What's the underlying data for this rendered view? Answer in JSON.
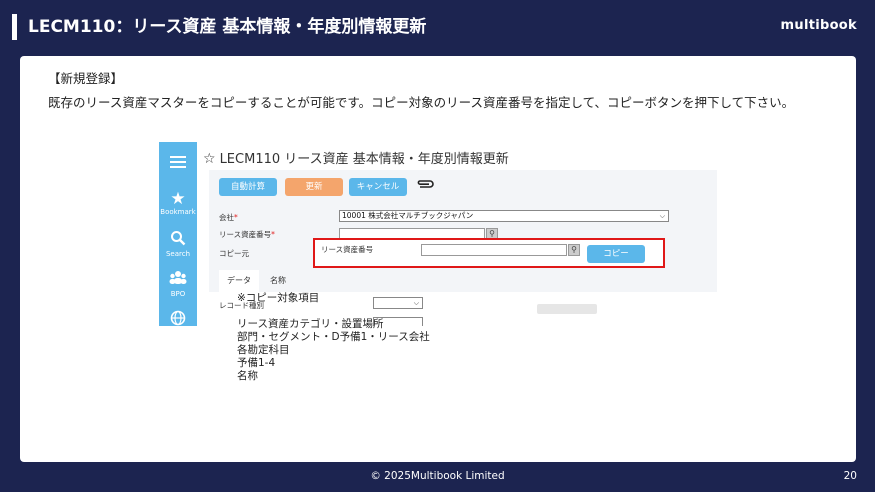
{
  "slide": {
    "title": "LECM110：リース資産 基本情報・年度別情報更新",
    "logo": "multibook",
    "section_label": "【新規登録】",
    "description": "既存のリース資産マスターをコピーすることが可能です。コピー対象のリース資産番号を指定して、コピーボタンを押下して下さい。",
    "footer": "© 2025Multibook Limited",
    "page_number": "20"
  },
  "screenshot": {
    "sidebar": {
      "items": [
        {
          "icon": "menu-icon",
          "label": ""
        },
        {
          "icon": "star-icon",
          "label": "Bookmark"
        },
        {
          "icon": "search-icon",
          "label": "Search"
        },
        {
          "icon": "people-icon",
          "label": "BPO"
        },
        {
          "icon": "globe-icon",
          "label": ""
        }
      ]
    },
    "app_title": "LECM110 リース資産 基本情報・年度別情報更新",
    "toolbar": {
      "auto_calc": "自動計算",
      "update": "更新",
      "cancel": "キャンセル"
    },
    "form": {
      "company_label": "会社",
      "company_value": "10001 株式会社マルチブックジャパン",
      "asset_no_label": "リース資産番号",
      "asset_no_value": "",
      "copy_from_label": "コピー元",
      "copy_asset_no_label": "リース資産番号",
      "copy_asset_no_value": "",
      "copy_button": "コピー"
    },
    "tabs": [
      {
        "label": "データ",
        "active": true
      },
      {
        "label": "名称",
        "active": false
      }
    ],
    "record_type_label": "レコード種別",
    "record_type_value": ""
  },
  "copy_items": {
    "heading": "※コピー対象項目",
    "lines": [
      "リース資産カテゴリ・設置場所",
      "部門・セグメント・D予備1・リース会社",
      "各勘定科目",
      "予備1-4",
      "名称"
    ]
  },
  "colors": {
    "background": "#1c2450",
    "sidebar": "#5bb7ea",
    "primary_button": "#5bb7ea",
    "update_button": "#f4a56c",
    "highlight": "#e01818",
    "required": "#e02020"
  }
}
